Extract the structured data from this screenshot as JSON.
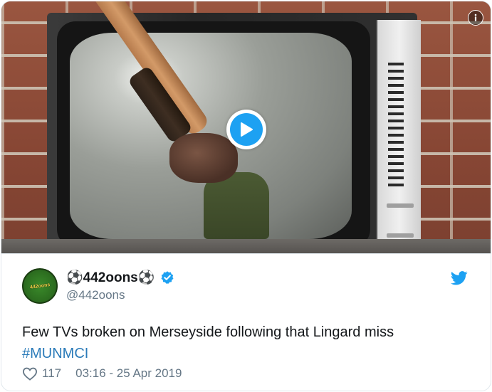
{
  "media": {
    "type": "video",
    "info_icon": "info-icon",
    "play_icon": "play-icon",
    "accent_color": "#1da1f2"
  },
  "tweet": {
    "author_name": "⚽442oons⚽",
    "author_handle": "@442oons",
    "avatar_text": "442oons",
    "verified_icon": "verified-badge-icon",
    "brand_icon": "twitter-bird-icon",
    "text": "Few TVs broken on Merseyside following that Lingard miss",
    "hashtag": "#MUNMCI",
    "likes": "117",
    "timestamp": "03:16 - 25 Apr 2019",
    "hashtag_color": "#2b7bb9",
    "secondary_text_color": "#657786"
  }
}
